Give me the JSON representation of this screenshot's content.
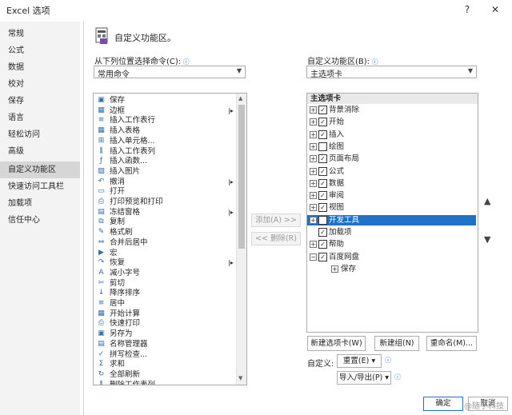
{
  "window": {
    "title": "Excel 选项",
    "help": "?",
    "close": "✕"
  },
  "nav": [
    {
      "label": "常规"
    },
    {
      "label": "公式"
    },
    {
      "label": "数据"
    },
    {
      "label": "校对"
    },
    {
      "label": "保存"
    },
    {
      "label": "语言"
    },
    {
      "label": "轻松访问"
    },
    {
      "label": "高级"
    },
    {
      "label": "自定义功能区",
      "selected": true
    },
    {
      "label": "快速访问工具栏"
    },
    {
      "label": "加载项"
    },
    {
      "label": "信任中心"
    }
  ],
  "header": {
    "title": "自定义功能区。"
  },
  "left_panel": {
    "label": "从下列位置选择命令(C):",
    "dropdown_value": "常用命令",
    "commands": [
      {
        "label": "保存",
        "icon": "save-icon"
      },
      {
        "label": "边框",
        "icon": "border-icon",
        "submenu": true
      },
      {
        "label": "插入工作表行",
        "icon": "insert-row-icon"
      },
      {
        "label": "插入表格",
        "icon": "insert-table-icon"
      },
      {
        "label": "插入单元格...",
        "icon": "insert-cells-icon"
      },
      {
        "label": "插入工作表列",
        "icon": "insert-column-icon"
      },
      {
        "label": "插入函数...",
        "icon": "function-icon"
      },
      {
        "label": "插入图片",
        "icon": "picture-icon"
      },
      {
        "label": "撤消",
        "icon": "undo-icon",
        "submenu": true
      },
      {
        "label": "打开",
        "icon": "open-icon"
      },
      {
        "label": "打印预览和打印",
        "icon": "print-preview-icon"
      },
      {
        "label": "冻结窗格",
        "icon": "freeze-panes-icon",
        "submenu": true
      },
      {
        "label": "复制",
        "icon": "copy-icon"
      },
      {
        "label": "格式刷",
        "icon": "format-painter-icon"
      },
      {
        "label": "合并后居中",
        "icon": "merge-center-icon"
      },
      {
        "label": "宏",
        "icon": "macro-icon"
      },
      {
        "label": "恢复",
        "icon": "redo-icon",
        "submenu": true
      },
      {
        "label": "减小字号",
        "icon": "decrease-font-icon"
      },
      {
        "label": "剪切",
        "icon": "cut-icon"
      },
      {
        "label": "降序排序",
        "icon": "sort-desc-icon"
      },
      {
        "label": "居中",
        "icon": "center-icon"
      },
      {
        "label": "开始计算",
        "icon": "calculate-icon"
      },
      {
        "label": "快速打印",
        "icon": "quick-print-icon"
      },
      {
        "label": "另存为",
        "icon": "save-as-icon"
      },
      {
        "label": "名称管理器",
        "icon": "name-manager-icon"
      },
      {
        "label": "拼写检查...",
        "icon": "spelling-icon"
      },
      {
        "label": "求和",
        "icon": "sum-icon"
      },
      {
        "label": "全部刷新",
        "icon": "refresh-icon"
      },
      {
        "label": "删除工作表列",
        "icon": "delete-column-icon"
      }
    ]
  },
  "middle": {
    "add_label": "添加(A) >>",
    "remove_label": "<< 删除(R)"
  },
  "right_panel": {
    "label": "自定义功能区(B):",
    "dropdown_value": "主选项卡",
    "header": "主选项卡",
    "tabs": [
      {
        "label": "背景消除",
        "checked": true,
        "expander": true
      },
      {
        "label": "开始",
        "checked": true,
        "expander": true
      },
      {
        "label": "插入",
        "checked": true,
        "expander": true
      },
      {
        "label": "绘图",
        "checked": false,
        "expander": true
      },
      {
        "label": "页面布局",
        "checked": true,
        "expander": true
      },
      {
        "label": "公式",
        "checked": true,
        "expander": true
      },
      {
        "label": "数据",
        "checked": true,
        "expander": true
      },
      {
        "label": "审阅",
        "checked": true,
        "expander": true
      },
      {
        "label": "视图",
        "checked": true,
        "expander": true
      },
      {
        "label": "开发工具",
        "checked": true,
        "expander": true,
        "selected": true
      },
      {
        "label": "加载项",
        "checked": true,
        "expander": false
      },
      {
        "label": "帮助",
        "checked": true,
        "expander": true
      },
      {
        "label": "百度网盘",
        "checked": true,
        "expander": true,
        "expanded": true
      },
      {
        "label": "保存",
        "child": true
      }
    ],
    "new_tab_button": "新建选项卡(W)",
    "new_group_button": "新建组(N)",
    "rename_button": "重命名(M)...",
    "customize_label": "自定义:",
    "reset_button": "重置(E) ▾",
    "import_export_button": "导入/导出(P) ▾"
  },
  "footer": {
    "ok": "确定",
    "cancel": "取消"
  },
  "watermark": "@随手科技"
}
